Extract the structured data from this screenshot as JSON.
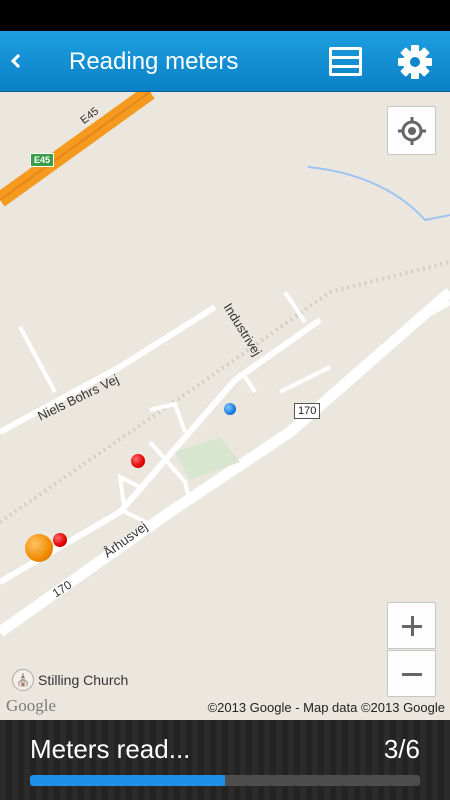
{
  "header": {
    "title": "Reading meters",
    "back_icon": "chevron-left-icon",
    "list_icon": "list-icon",
    "settings_icon": "gear-icon",
    "color": "#1592d8"
  },
  "map": {
    "labels": {
      "highway": "E45",
      "highway_shield": "E45",
      "road_170_a": "170",
      "road_170_b": "170",
      "niels_bohrs_vej": "Niels Bohrs Vej",
      "industrivej": "Industrivej",
      "arhusvej": "Århusvej"
    },
    "poi": {
      "label": "Stilling Church",
      "icon": "church-icon"
    },
    "google_logo": "Google",
    "copyright": "©2013 Google - Map data ©2013 Google",
    "markers": [
      {
        "color": "blue",
        "icon": "current-location-marker"
      },
      {
        "color": "red",
        "icon": "meter-marker"
      },
      {
        "color": "red",
        "icon": "meter-marker"
      },
      {
        "color": "orange",
        "icon": "cluster-marker"
      }
    ],
    "controls": {
      "locate_icon": "crosshair-icon",
      "zoom_in_icon": "plus-icon",
      "zoom_out_icon": "minus-icon"
    }
  },
  "footer": {
    "label": "Meters read...",
    "count": "3/6",
    "progress_fraction": 0.5,
    "progress_color": "#1f8fe8"
  }
}
